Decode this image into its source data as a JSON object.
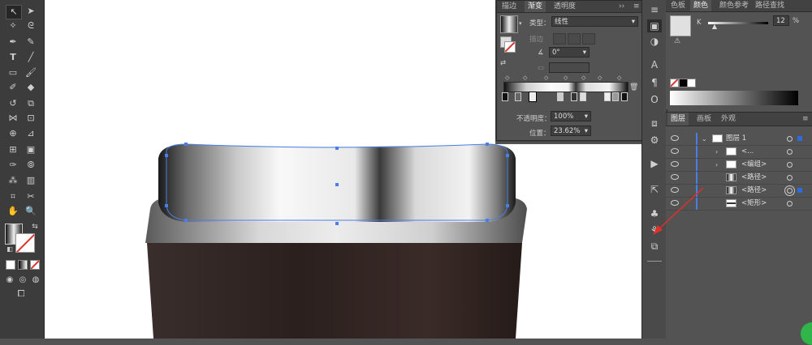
{
  "gradient_panel": {
    "tabs": [
      "描边",
      "渐变",
      "透明度"
    ],
    "active_tab": "渐变",
    "type_label": "类型：",
    "type_value": "线性",
    "stroke_label": "描边",
    "angle_value": "0°",
    "opacity_label": "不透明度：",
    "opacity_value": "100%",
    "position_label": "位置：",
    "position_value": "23.62%"
  },
  "color_panel": {
    "tabs": [
      "色板",
      "颜色",
      "颜色参考",
      "路径查找"
    ],
    "active_tab": "颜色",
    "channel_label": "K",
    "k_value": "12",
    "k_fraction": 0.12,
    "percent": "%"
  },
  "layers_panel": {
    "tabs": [
      "图层",
      "画板",
      "外观"
    ],
    "active_tab": "图层",
    "rows": [
      {
        "name": "图层 1",
        "twisty": "⌄"
      },
      {
        "name": "<...",
        "twisty": "›"
      },
      {
        "name": "<编组>",
        "twisty": "›"
      },
      {
        "name": "<路径>",
        "twisty": ""
      },
      {
        "name": "<路径>",
        "twisty": ""
      },
      {
        "name": "<矩形>",
        "twisty": ""
      }
    ]
  },
  "colors": {
    "ui_bg": "#535353",
    "selection_blue": "#4a7ee6",
    "annotation_red": "#e0302a",
    "dark_brown": "#2e2320"
  }
}
